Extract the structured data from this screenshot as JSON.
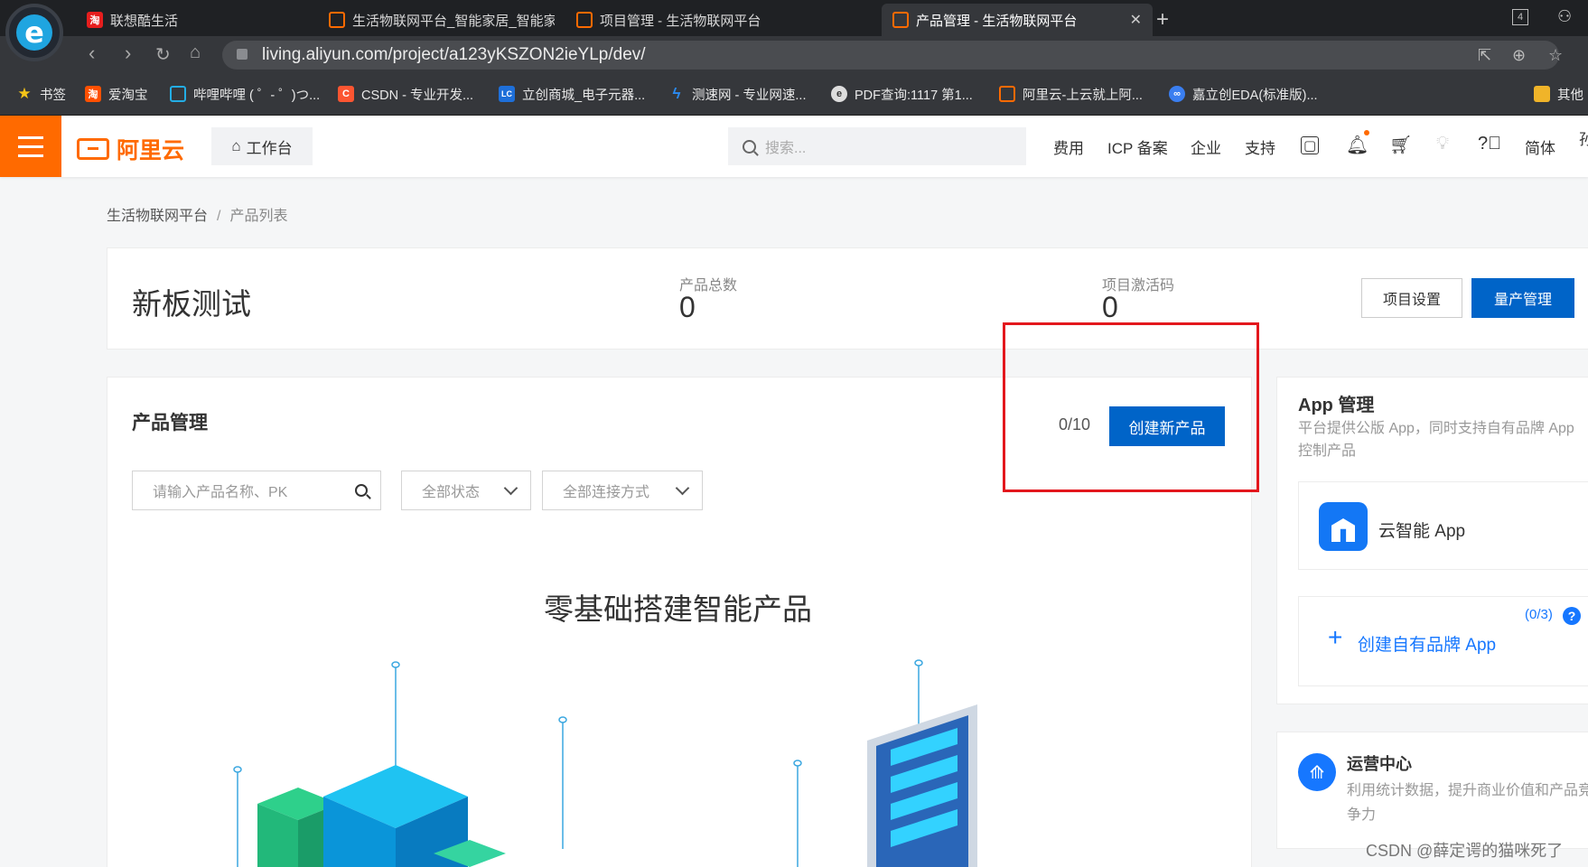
{
  "browser": {
    "tabs": [
      {
        "title": "联想酷生活",
        "favicon": "red-store-icon"
      },
      {
        "title": "生活物联网平台_智能家居_智能家电",
        "favicon": "aliyun-icon"
      },
      {
        "title": "项目管理 - 生活物联网平台",
        "favicon": "aliyun-icon"
      },
      {
        "title": "产品管理 - 生活物联网平台",
        "favicon": "aliyun-icon",
        "active": true
      }
    ],
    "tab_count": "4",
    "url": "living.aliyun.com/project/a123yKSZON2ieYLp/dev/",
    "bookmarks": [
      {
        "label": "书签",
        "icon": "star-icon"
      },
      {
        "label": "爱淘宝",
        "icon": "taobao-icon"
      },
      {
        "label": "哔哩哔哩 ( ゜- ゜)つ...",
        "icon": "bilibili-icon"
      },
      {
        "label": "CSDN - 专业开发...",
        "icon": "csdn-icon"
      },
      {
        "label": "立创商城_电子元器...",
        "icon": "lc-icon"
      },
      {
        "label": "测速网 - 专业网速...",
        "icon": "speedtest-icon"
      },
      {
        "label": "PDF查询:1117 第1...",
        "icon": "pdf-icon"
      },
      {
        "label": "阿里云-上云就上阿...",
        "icon": "aliyun-icon"
      },
      {
        "label": "嘉立创EDA(标准版)...",
        "icon": "eda-icon"
      },
      {
        "label": "其他",
        "icon": "folder-icon"
      }
    ]
  },
  "topnav": {
    "brand": "阿里云",
    "workbench": "工作台",
    "search_placeholder": "搜索...",
    "links": [
      "费用",
      "ICP 备案",
      "企业",
      "支持"
    ],
    "lang": "简体",
    "edge_text": "孙"
  },
  "breadcrumb": {
    "root": "生活物联网平台",
    "separator": "/",
    "current": "产品列表"
  },
  "project": {
    "name": "新板测试",
    "stats": [
      {
        "label": "产品总数",
        "value": "0"
      },
      {
        "label": "项目激活码",
        "value": "0"
      }
    ],
    "settings_button": "项目设置",
    "mass_button": "量产管理"
  },
  "products": {
    "title": "产品管理",
    "quota": "0/10",
    "create_button": "创建新产品",
    "filter_placeholder": "请输入产品名称、PK",
    "status_select": "全部状态",
    "connection_select": "全部连接方式",
    "empty_title": "零基础搭建智能产品"
  },
  "app_panel": {
    "title": "App 管理",
    "desc": "平台提供公版 App，同时支持自有品牌 App 控制产品",
    "smart_app": "云智能 App",
    "brand_count": "(0/3)",
    "brand_label": "创建自有品牌 App"
  },
  "ops_panel": {
    "title": "运营中心",
    "desc": "利用统计数据，提升商业价值和产品竞争力"
  },
  "watermark": "CSDN @薛定谔的猫咪死了",
  "colors": {
    "accent": "#ff6a00",
    "primary": "#0064c8",
    "highlight": "#e3171d"
  }
}
